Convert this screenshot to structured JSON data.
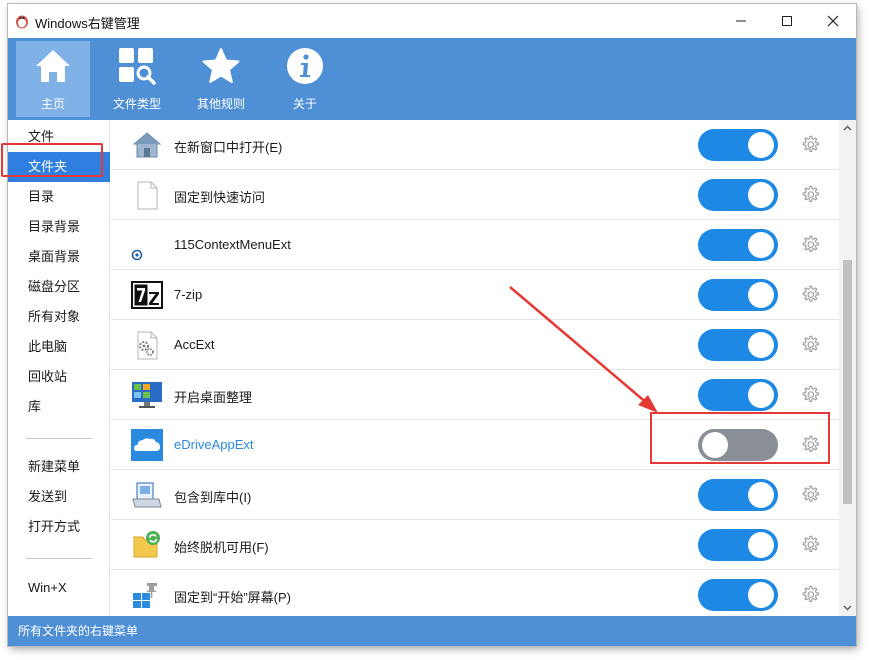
{
  "window": {
    "title": "Windows右键管理",
    "minimize_label": "—",
    "maximize_label": "☐",
    "close_label": "✕"
  },
  "toolbar": {
    "items": [
      {
        "label": "主页",
        "icon": "home-icon",
        "active": true
      },
      {
        "label": "文件类型",
        "icon": "file-types-icon",
        "active": false
      },
      {
        "label": "其他规则",
        "icon": "star-icon",
        "active": false
      },
      {
        "label": "关于",
        "icon": "info-icon",
        "active": false
      }
    ]
  },
  "sidebar": {
    "items": [
      {
        "label": "文件"
      },
      {
        "label": "文件夹",
        "selected": true
      },
      {
        "label": "目录"
      },
      {
        "label": "目录背景"
      },
      {
        "label": "桌面背景"
      },
      {
        "label": "磁盘分区"
      },
      {
        "label": "所有对象"
      },
      {
        "label": "此电脑"
      },
      {
        "label": "回收站"
      },
      {
        "label": "库"
      },
      {
        "label": "新建菜单"
      },
      {
        "label": "发送到"
      },
      {
        "label": "打开方式"
      },
      {
        "label": "Win+X"
      }
    ]
  },
  "entries": [
    {
      "label": "在新窗口中打开(E)",
      "icon": "house-icon",
      "enabled": true
    },
    {
      "label": "固定到快速访问",
      "icon": "blank-file-icon",
      "enabled": true
    },
    {
      "label": "115ContextMenuExt",
      "icon": "115-icon",
      "enabled": true
    },
    {
      "label": "7-zip",
      "icon": "7zip-icon",
      "enabled": true
    },
    {
      "label": "AccExt",
      "icon": "gear-file-icon",
      "enabled": true
    },
    {
      "label": "开启桌面整理",
      "icon": "monitor-icon",
      "enabled": true
    },
    {
      "label": "eDriveAppExt",
      "icon": "cloud-icon",
      "enabled": false
    },
    {
      "label": "包含到库中(I)",
      "icon": "library-icon",
      "enabled": true
    },
    {
      "label": "始终脱机可用(F)",
      "icon": "sync-folder-icon",
      "enabled": true
    },
    {
      "label": "固定到“开始”屏幕(P)",
      "icon": "pin-start-icon",
      "enabled": true
    }
  ],
  "statusbar": {
    "text": "所有文件夹的右键菜单"
  },
  "colors": {
    "accent": "#4f8fd6",
    "toggle_on": "#1e88e5",
    "toggle_off": "#8a8e96",
    "highlight": "#e53935"
  }
}
